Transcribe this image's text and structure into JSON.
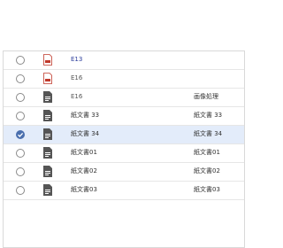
{
  "rows": [
    {
      "name": "E13",
      "extra": "",
      "selected": false,
      "icon": "pdf-file-icon",
      "link": true
    },
    {
      "name": "E16",
      "extra": "",
      "selected": false,
      "icon": "pdf-file-icon",
      "link": false
    },
    {
      "name": "E16",
      "extra": "画像処理",
      "selected": false,
      "icon": "document-file-icon",
      "link": false
    },
    {
      "name": "紙文書 33",
      "extra": "紙文書 33",
      "selected": false,
      "icon": "document-file-icon",
      "link": false
    },
    {
      "name": "紙文書 34",
      "extra": "紙文書 34",
      "selected": true,
      "icon": "document-file-icon",
      "link": false
    },
    {
      "name": "紙文書01",
      "extra": "紙文書01",
      "selected": false,
      "icon": "document-file-icon",
      "link": false
    },
    {
      "name": "紙文書02",
      "extra": "紙文書02",
      "selected": false,
      "icon": "document-file-icon",
      "link": false
    },
    {
      "name": "紙文書03",
      "extra": "紙文書03",
      "selected": false,
      "icon": "document-file-icon",
      "link": false
    }
  ],
  "colors": {
    "selected_bg": "#e3ecfa",
    "radio_checked": "#4a6fae",
    "pdf_icon": "#c0392b",
    "doc_icon": "#555555"
  }
}
